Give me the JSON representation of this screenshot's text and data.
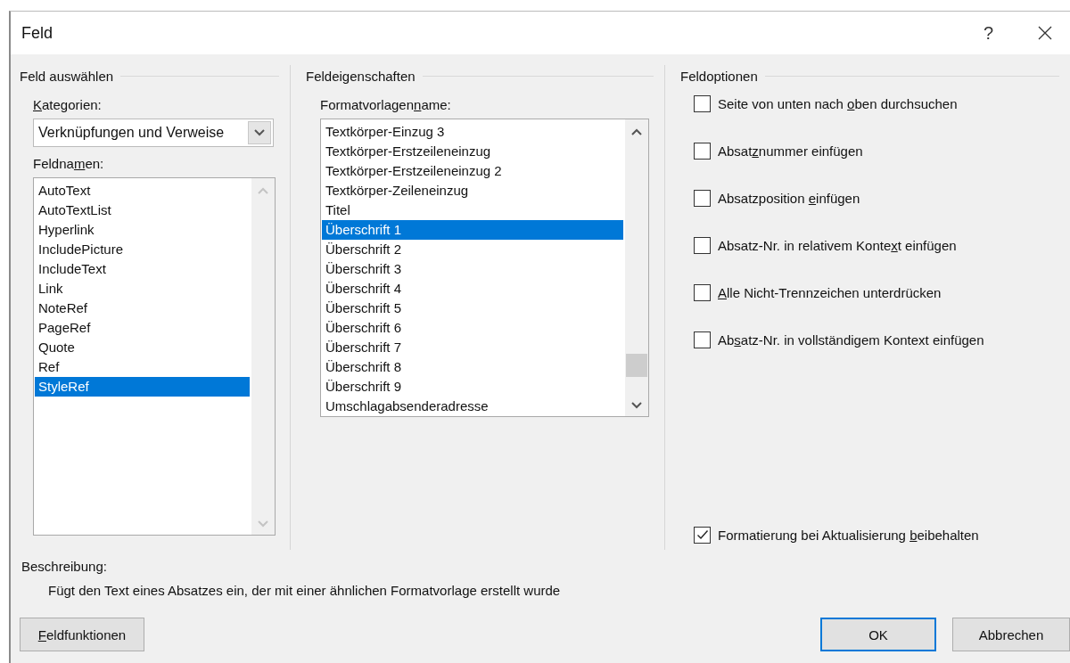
{
  "window": {
    "title": "Feld",
    "help": "?"
  },
  "select_field": {
    "title": "Feld auswählen",
    "categories_label": {
      "key": "K",
      "after": "ategorien:"
    },
    "category": "Verknüpfungen und Verweise",
    "field_names_label": {
      "before": "Feldna",
      "key": "m",
      "after": "en:"
    },
    "field_names": [
      {
        "label": "AutoText",
        "selected": false
      },
      {
        "label": "AutoTextList",
        "selected": false
      },
      {
        "label": "Hyperlink",
        "selected": false
      },
      {
        "label": "IncludePicture",
        "selected": false
      },
      {
        "label": "IncludeText",
        "selected": false
      },
      {
        "label": "Link",
        "selected": false
      },
      {
        "label": "NoteRef",
        "selected": false
      },
      {
        "label": "PageRef",
        "selected": false
      },
      {
        "label": "Quote",
        "selected": false
      },
      {
        "label": "Ref",
        "selected": false
      },
      {
        "label": "StyleRef",
        "selected": true
      }
    ]
  },
  "field_properties": {
    "title": "Feldeigenschaften",
    "style_name_label": {
      "before": "Formatvorlagen",
      "key": "n",
      "after": "ame:"
    },
    "styles": [
      {
        "label": "Textkörper-Einzug 3",
        "selected": false
      },
      {
        "label": "Textkörper-Erstzeileneinzug",
        "selected": false
      },
      {
        "label": "Textkörper-Erstzeileneinzug 2",
        "selected": false
      },
      {
        "label": "Textkörper-Zeileneinzug",
        "selected": false
      },
      {
        "label": "Titel",
        "selected": false
      },
      {
        "label": "Überschrift 1",
        "selected": true
      },
      {
        "label": "Überschrift 2",
        "selected": false
      },
      {
        "label": "Überschrift 3",
        "selected": false
      },
      {
        "label": "Überschrift 4",
        "selected": false
      },
      {
        "label": "Überschrift 5",
        "selected": false
      },
      {
        "label": "Überschrift 6",
        "selected": false
      },
      {
        "label": "Überschrift 7",
        "selected": false
      },
      {
        "label": "Überschrift 8",
        "selected": false
      },
      {
        "label": "Überschrift 9",
        "selected": false
      },
      {
        "label": "Umschlagabsenderadresse",
        "selected": false
      }
    ]
  },
  "field_options": {
    "title": "Feldoptionen",
    "options": [
      {
        "label": {
          "before": "Seite von unten nach ",
          "key": "o",
          "after": "ben durchsuchen"
        },
        "checked": false
      },
      {
        "label": {
          "before": "Absat",
          "key": "z",
          "after": "nummer einfügen"
        },
        "checked": false
      },
      {
        "label": {
          "before": "Absatzposition ",
          "key": "e",
          "after": "infügen"
        },
        "checked": false
      },
      {
        "label": {
          "before": "Absatz-Nr. in relativem Konte",
          "key": "x",
          "after": "t einfügen"
        },
        "checked": false
      },
      {
        "label": {
          "key": "A",
          "after": "lle Nicht-Trennzeichen unterdrücken"
        },
        "checked": false
      },
      {
        "label": {
          "before": "Ab",
          "key": "s",
          "after": "atz-Nr. in vollständigem Kontext einfügen"
        },
        "checked": false
      }
    ],
    "keep_formatting": {
      "label": {
        "before": "Formatierung bei Aktualisierung ",
        "key": "b",
        "after": "eibehalten"
      },
      "checked": true
    }
  },
  "description": {
    "label": "Beschreibung:",
    "text": "Fügt den Text eines Absatzes ein, der mit einer ähnlichen Formatvorlage erstellt wurde"
  },
  "buttons": [
    {
      "label": {
        "key": "F",
        "after": "eldfunktionen"
      },
      "default": false
    },
    {
      "label": {
        "before": "OK"
      },
      "default": true
    },
    {
      "label": {
        "before": "Abbrechen"
      },
      "default": false
    }
  ]
}
